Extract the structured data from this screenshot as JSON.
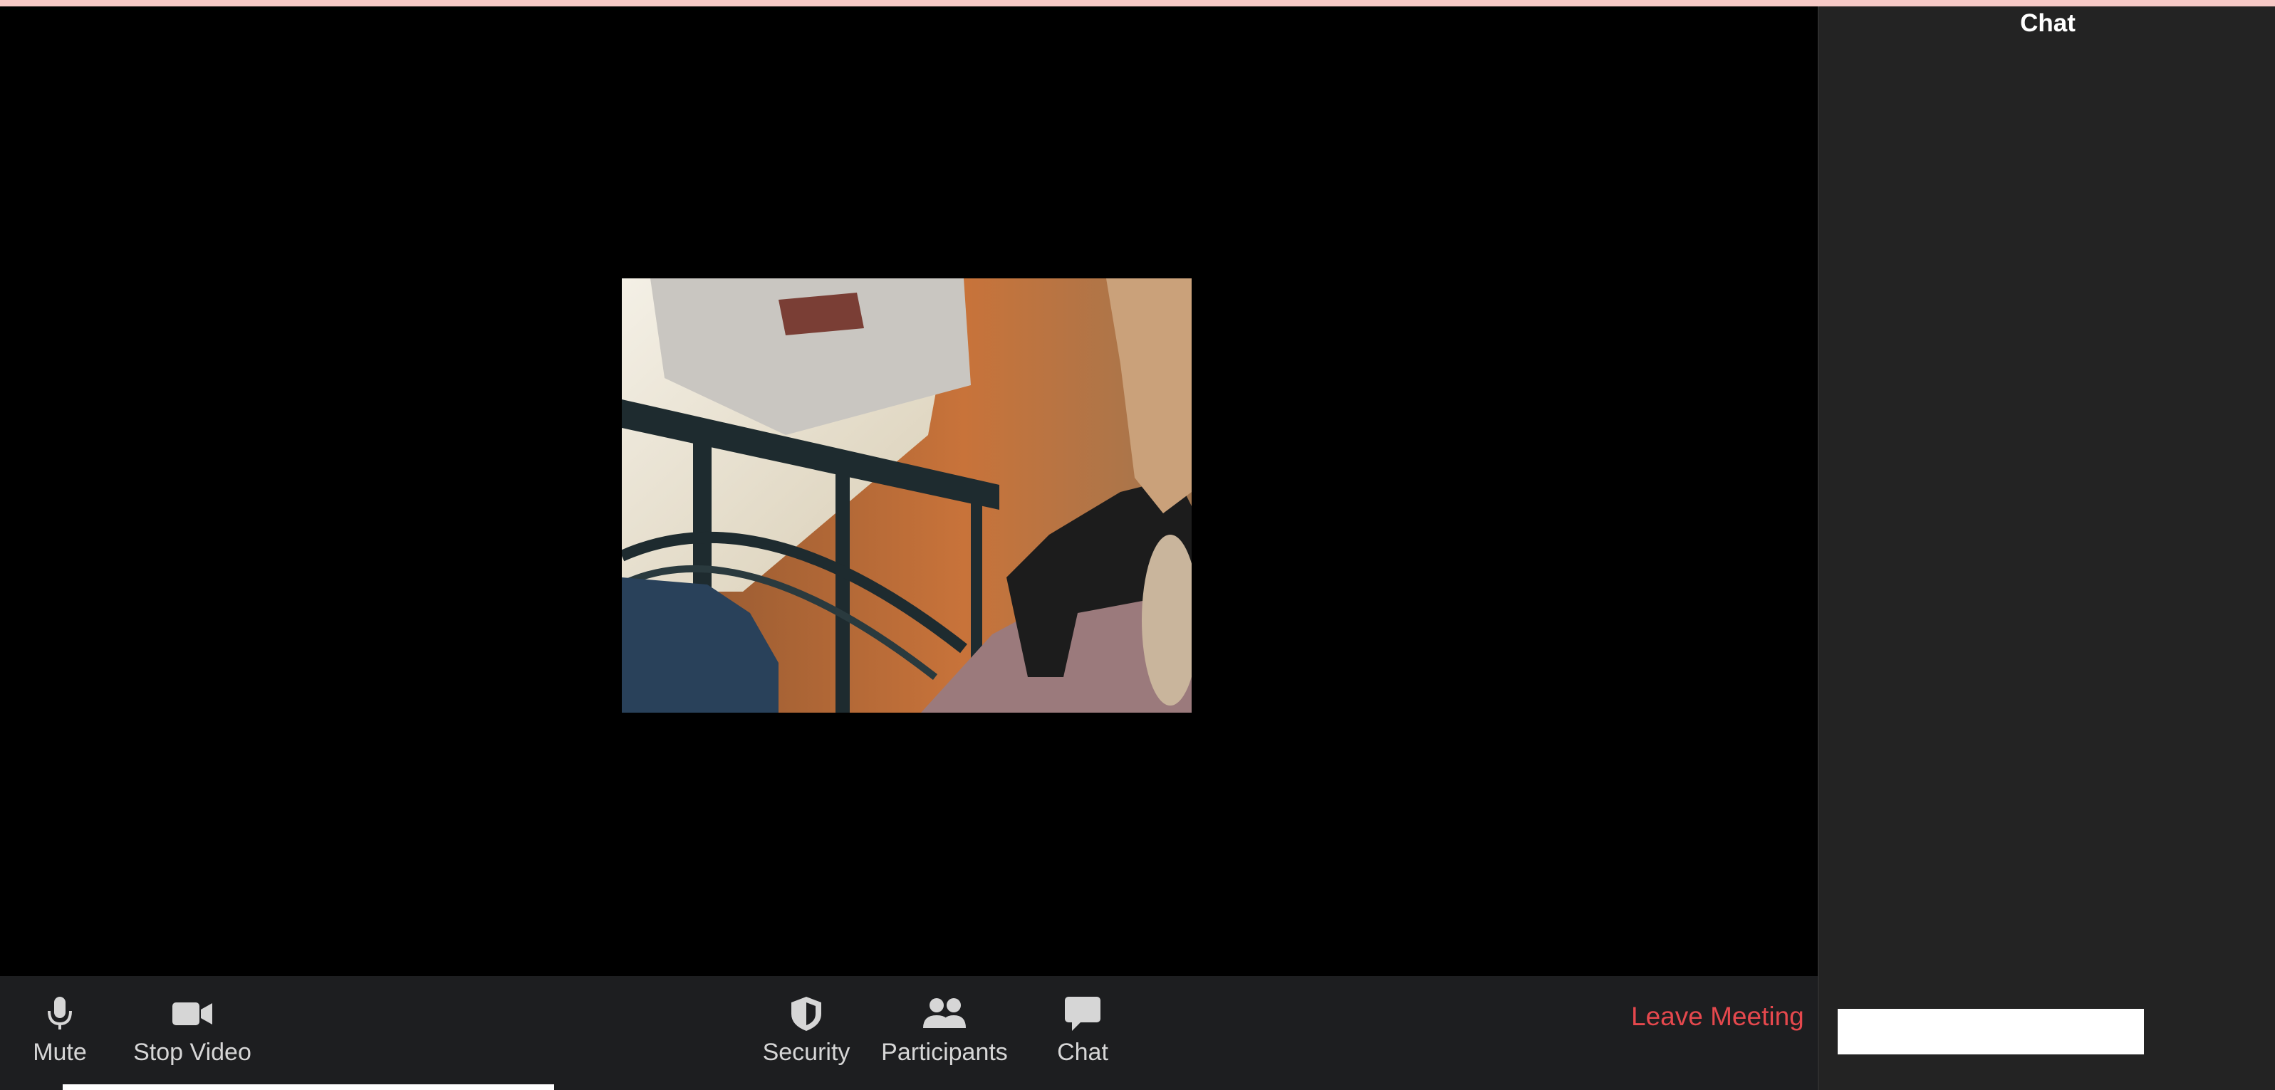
{
  "top_strip_color": "#f7c9c6",
  "chat_panel": {
    "title": "Chat",
    "input_placeholder": ""
  },
  "toolbar": {
    "mute_label": "Mute",
    "stop_video_label": "Stop Video",
    "security_label": "Security",
    "participants_label": "Participants",
    "chat_label": "Chat",
    "leave_label": "Leave Meeting"
  },
  "icons": {
    "mute": "microphone-icon",
    "stop_video": "video-camera-icon",
    "security": "shield-icon",
    "participants": "people-icon",
    "chat": "chat-bubble-icon"
  },
  "colors": {
    "leave": "#e5484d",
    "toolbar_bg": "#1d1e20",
    "chat_bg": "#232323"
  }
}
